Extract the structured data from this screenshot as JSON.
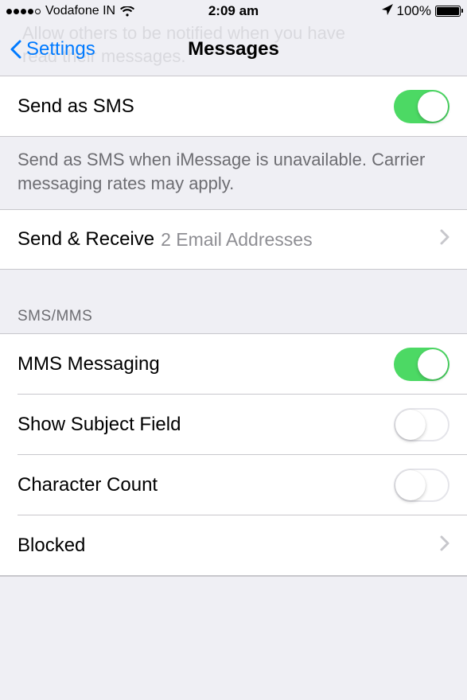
{
  "status": {
    "carrier": "Vodafone IN",
    "time": "2:09 am",
    "battery_pct": "100%"
  },
  "nav": {
    "back": "Settings",
    "title": "Messages"
  },
  "send_sms": {
    "label": "Send as SMS",
    "on": true,
    "footer": "Send as SMS when iMessage is unavailable. Carrier messaging rates may apply."
  },
  "send_receive": {
    "label": "Send & Receive",
    "value": "2 Email Addresses"
  },
  "section_header": "SMS/MMS",
  "rows": {
    "mms": {
      "label": "MMS Messaging",
      "on": true
    },
    "subject": {
      "label": "Show Subject Field",
      "on": false
    },
    "charcount": {
      "label": "Character Count",
      "on": false
    },
    "blocked": {
      "label": "Blocked"
    }
  }
}
